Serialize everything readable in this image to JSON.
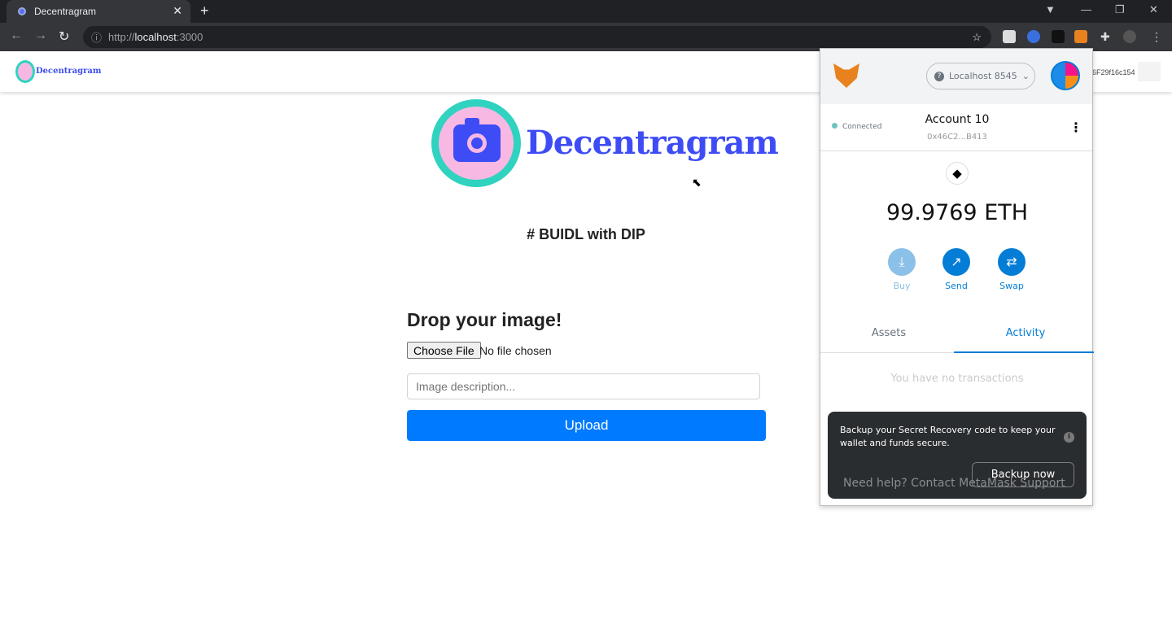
{
  "browser": {
    "tab_title": "Decentragram",
    "url_scheme": "http://",
    "url_host": "localhost",
    "url_port": ":3000"
  },
  "app": {
    "brand": "Decentragram",
    "account_short": "6F29f16c154",
    "tagline": "# BUIDL with DIP",
    "drop_title": "Drop your image!",
    "choose_file": "Choose File",
    "no_file": "No file chosen",
    "description_placeholder": "Image description...",
    "upload_label": "Upload"
  },
  "metamask": {
    "network": "Localhost 8545",
    "status": "Connected",
    "account_name": "Account 10",
    "account_address": "0x46C2...B413",
    "balance": "99.9769 ETH",
    "actions": [
      {
        "label": "Buy",
        "icon": "download-icon"
      },
      {
        "label": "Send",
        "icon": "arrow-up-right-icon"
      },
      {
        "label": "Swap",
        "icon": "swap-icon"
      }
    ],
    "tabs": [
      "Assets",
      "Activity"
    ],
    "active_tab": "Activity",
    "empty_text": "You have no transactions",
    "help_text": "Need help? Contact MetaMask Support",
    "toast_text": "Backup your Secret Recovery code to keep your wallet and funds secure.",
    "toast_button": "Backup now",
    "accent": "#037dd6"
  }
}
